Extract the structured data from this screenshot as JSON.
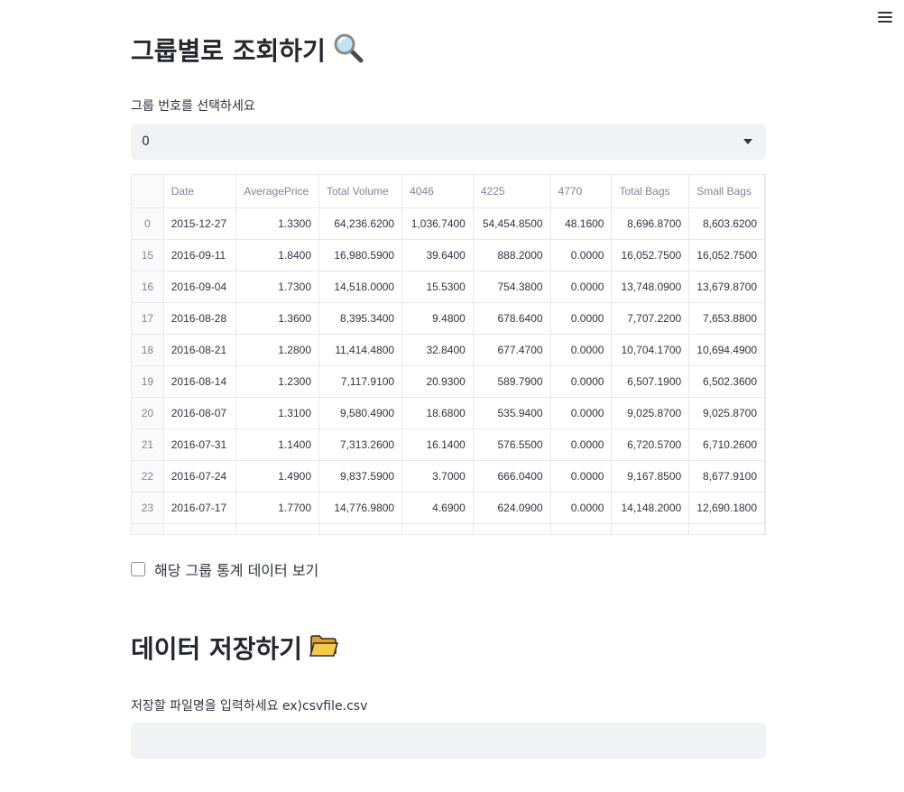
{
  "header": {
    "menu_icon": "hamburger-menu-icon"
  },
  "section_group": {
    "title": "그룹별로 조회하기",
    "title_icon": "magnifying-glass-icon",
    "select_label": "그룹 번호를 선택하세요",
    "select_value": "0"
  },
  "table": {
    "columns": [
      "",
      "Date",
      "AveragePrice",
      "Total Volume",
      "4046",
      "4225",
      "4770",
      "Total Bags",
      "Small Bags"
    ],
    "rows": [
      [
        "0",
        "2015-12-27",
        "1.3300",
        "64,236.6200",
        "1,036.7400",
        "54,454.8500",
        "48.1600",
        "8,696.8700",
        "8,603.6200"
      ],
      [
        "15",
        "2016-09-11",
        "1.8400",
        "16,980.5900",
        "39.6400",
        "888.2000",
        "0.0000",
        "16,052.7500",
        "16,052.7500"
      ],
      [
        "16",
        "2016-09-04",
        "1.7300",
        "14,518.0000",
        "15.5300",
        "754.3800",
        "0.0000",
        "13,748.0900",
        "13,679.8700"
      ],
      [
        "17",
        "2016-08-28",
        "1.3600",
        "8,395.3400",
        "9.4800",
        "678.6400",
        "0.0000",
        "7,707.2200",
        "7,653.8800"
      ],
      [
        "18",
        "2016-08-21",
        "1.2800",
        "11,414.4800",
        "32.8400",
        "677.4700",
        "0.0000",
        "10,704.1700",
        "10,694.4900"
      ],
      [
        "19",
        "2016-08-14",
        "1.2300",
        "7,117.9100",
        "20.9300",
        "589.7900",
        "0.0000",
        "6,507.1900",
        "6,502.3600"
      ],
      [
        "20",
        "2016-08-07",
        "1.3100",
        "9,580.4900",
        "18.6800",
        "535.9400",
        "0.0000",
        "9,025.8700",
        "9,025.8700"
      ],
      [
        "21",
        "2016-07-31",
        "1.1400",
        "7,313.2600",
        "16.1400",
        "576.5500",
        "0.0000",
        "6,720.5700",
        "6,710.2600"
      ],
      [
        "22",
        "2016-07-24",
        "1.4900",
        "9,837.5900",
        "3.7000",
        "666.0400",
        "0.0000",
        "9,167.8500",
        "8,677.9100"
      ],
      [
        "23",
        "2016-07-17",
        "1.7700",
        "14,776.9800",
        "4.6900",
        "624.0900",
        "0.0000",
        "14,148.2000",
        "12,690.1800"
      ]
    ]
  },
  "checkbox": {
    "label": "해당 그룹 통계 데이터 보기",
    "checked": false
  },
  "section_save": {
    "title": "데이터 저장하기",
    "title_icon": "folder-icon",
    "input_label": "저장할 파일명을 입력하세요 ex)csvfile.csv",
    "input_value": "",
    "input_placeholder": ""
  },
  "colors": {
    "input_bg": "#f0f2f6",
    "text": "#31333f",
    "muted": "#808495",
    "border": "#e6e8ec"
  }
}
